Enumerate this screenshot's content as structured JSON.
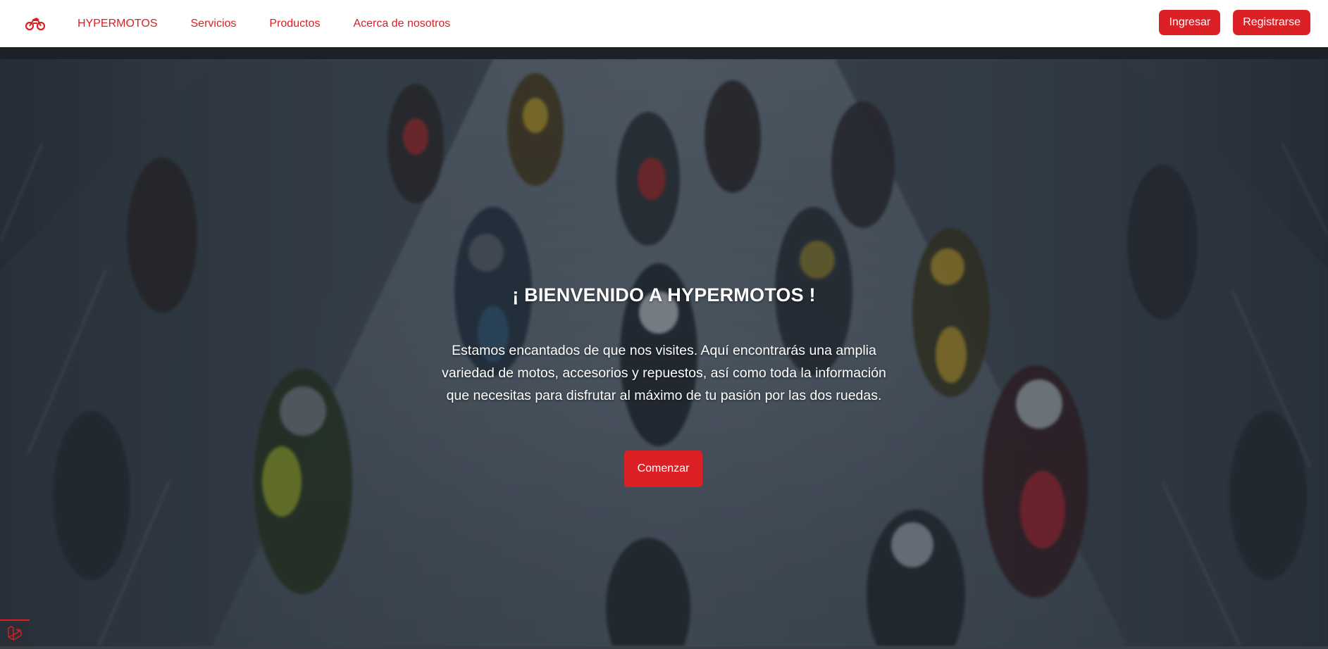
{
  "navbar": {
    "brand_icon": "motorcycle-logo-icon",
    "links": [
      {
        "label": "HYPERMOTOS"
      },
      {
        "label": "Servicios"
      },
      {
        "label": "Productos"
      },
      {
        "label": "Acerca de nosotros"
      }
    ],
    "login_label": "Ingresar",
    "register_label": "Registrarse"
  },
  "hero": {
    "title": "¡ BIENVENIDO A HYPERMOTOS !",
    "description": "Estamos encantados de que nos visites. Aquí encontrarás una amplia variedad de motos, accesorios y repuestos, así como toda la información que necesitas para disfrutar al máximo de tu pasión por las dos ruedas.",
    "cta_label": "Comenzar",
    "background_image": "motorcyclists-racing-blurred-photo"
  },
  "corner_badge": {
    "icon": "laravel-logo-icon"
  },
  "colors": {
    "brand_red": "#dc2126",
    "nav_bg": "#ffffff",
    "hero_text": "#ffffff"
  }
}
